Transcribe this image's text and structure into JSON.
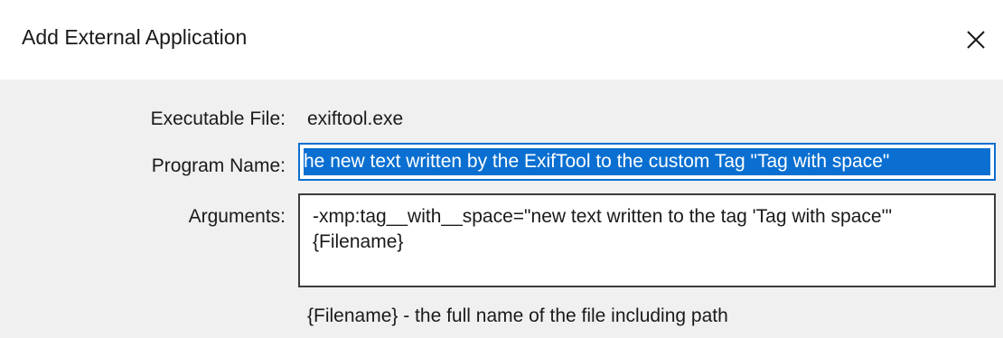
{
  "dialog": {
    "title": "Add External Application",
    "close_icon": "close-icon"
  },
  "form": {
    "executable_label": "Executable File:",
    "executable_value": "exiftool.exe",
    "program_name_label": "Program Name:",
    "program_name_value": "he new text written by the ExifTool to the custom Tag \"Tag with space\"",
    "arguments_label": "Arguments:",
    "arguments_value": "-xmp:tag__with__space=\"new text written to the tag 'Tag with space'\" {Filename}",
    "hint": "{Filename} - the full name of the file including path"
  },
  "colors": {
    "selection": "#0a6fd1",
    "background": "#f0f0f0"
  }
}
